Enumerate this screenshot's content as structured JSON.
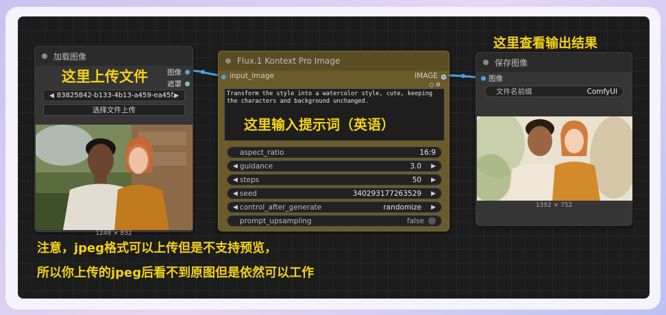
{
  "load_node": {
    "title": "加载图像",
    "port_image": "图像",
    "port_mask": "遮罩",
    "file_value": "83825842-b133-4b13-a459-ea45f...",
    "upload_button": "选择文件上传",
    "image_size": "1248 × 832"
  },
  "flux_node": {
    "title": "Flux.1 Kontext Pro Image",
    "input_label": "input_image",
    "output_label": "IMAGE",
    "prompt": "Transform the style into a watercolor style, cute, keeping the characters and background unchanged.",
    "params": [
      {
        "label": "aspect_ratio",
        "value": "16:9"
      },
      {
        "label": "guidance",
        "value": "3.0"
      },
      {
        "label": "steps",
        "value": "50"
      },
      {
        "label": "seed",
        "value": "340293177263529"
      },
      {
        "label": "control_after_generate",
        "value": "randomize"
      },
      {
        "label": "prompt_upsampling",
        "value": "false"
      }
    ]
  },
  "save_node": {
    "title": "保存图像",
    "port_image": "图像",
    "prefix_label": "文件名前缀",
    "prefix_value": "ComfyUI",
    "image_size": "1392 × 752"
  },
  "annotations": {
    "upload_here": "这里上传文件",
    "output_here": "这里查看输出结果",
    "prompt_here": "这里输入提示词（英语）",
    "note_line1": "注意，jpeg格式可以上传但是不支持预览，",
    "note_line2": "所以你上传的jpeg后看不到原图但是依然可以工作"
  },
  "colors": {
    "annotation": "#f4d21a",
    "flux_node_bg": "#6b5b2a",
    "link_blue": "#4aa3df"
  }
}
